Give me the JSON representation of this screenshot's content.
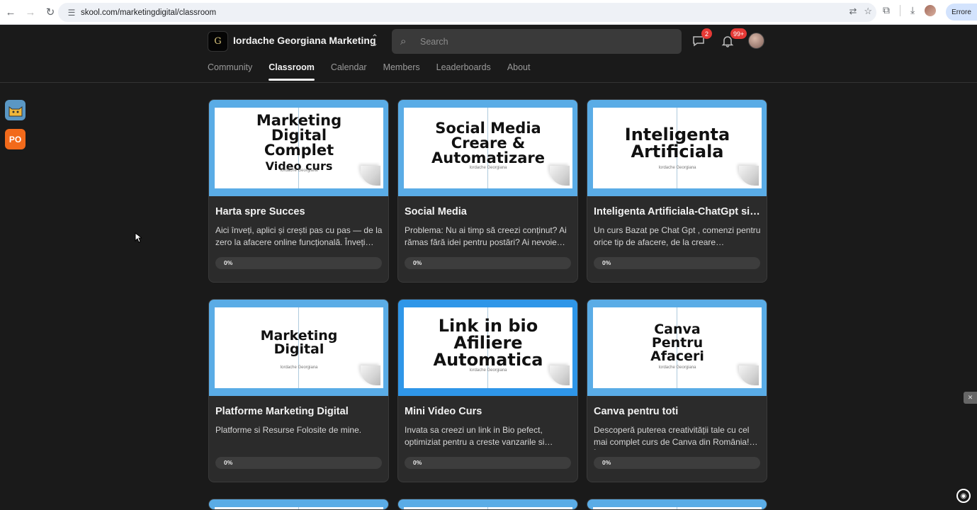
{
  "browser": {
    "url": "skool.com/marketingdigital/classroom",
    "error_label": "Errore",
    "icons": [
      "back-arrow-icon",
      "forward-arrow-icon",
      "reload-icon",
      "site-info-icon",
      "translate-icon",
      "star-icon",
      "extensions-icon",
      "download-icon"
    ]
  },
  "header": {
    "group_logo_text": "G",
    "group_name": "Iordache Georgiana Marketing",
    "search_placeholder": "Search",
    "chat_badge": "2",
    "notif_badge": "99+",
    "tabs": [
      {
        "label": "Community",
        "active": false
      },
      {
        "label": "Classroom",
        "active": true
      },
      {
        "label": "Calendar",
        "active": false
      },
      {
        "label": "Members",
        "active": false
      },
      {
        "label": "Leaderboards",
        "active": false
      },
      {
        "label": "About",
        "active": false
      }
    ]
  },
  "side_apps": [
    {
      "label": "",
      "color": "#5a97c4"
    },
    {
      "label": "PO",
      "color": "#f26a1b"
    }
  ],
  "courses": [
    {
      "thumb_lines": [
        "Marketing",
        "Digital",
        "Complet",
        "Video curs"
      ],
      "thumb_sub": "Iordache Georgiana",
      "title": "Harta spre Succes",
      "description": "Aici înveți, aplici și crești pas cu pas — de la zero la afacere online funcțională. Înveți…",
      "progress": "0%"
    },
    {
      "thumb_lines": [
        "Social Media",
        "Creare &",
        "Automatizare"
      ],
      "thumb_sub": "Iordache Georgiana",
      "title": "Social Media",
      "description": "Problema: Nu ai timp să creezi conținut? Ai rămas fără idei pentru postări? Ai nevoie de…",
      "progress": "0%"
    },
    {
      "thumb_lines": [
        "Inteligenta",
        "Artificiala"
      ],
      "thumb_sub": "Iordache Georgiana",
      "title": "Inteligenta Artificiala-ChatGpt si n…",
      "description": "Un curs Bazat pe Chat Gpt , comenzi pentru orice tip de afacere, de la creare…",
      "progress": "0%"
    },
    {
      "thumb_lines": [
        "Marketing",
        "Digital"
      ],
      "thumb_sub": "Iordache Georgiana",
      "title": "Platforme Marketing Digital",
      "description": "Platforme si Resurse Folosite de mine.",
      "progress": "0%"
    },
    {
      "thumb_lines": [
        "Link in bio",
        "Afiliere",
        "Automatica"
      ],
      "thumb_sub": "Iordache Georgiana",
      "title": "Mini Video Curs",
      "description": "Invata sa creezi un link in Bio pefect, optimiziat pentru a creste vanzarile si lead-…",
      "progress": "0%"
    },
    {
      "thumb_lines": [
        "Canva",
        "Pentru",
        "Afaceri"
      ],
      "thumb_sub": "Iordache Georgiana",
      "title": "Canva pentru toti",
      "description": "Descoperă puterea creativității tale cu cel mai complet curs de Canva din România! În…",
      "progress": "0%"
    }
  ]
}
